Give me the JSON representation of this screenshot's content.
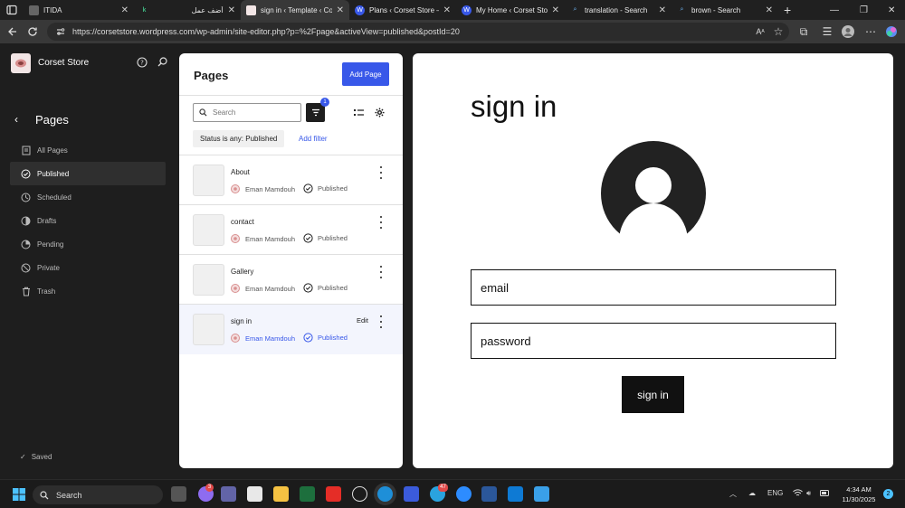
{
  "browser": {
    "tabs": [
      {
        "label": "ITIDA",
        "active": false
      },
      {
        "label": "أضف عمل",
        "active": false
      },
      {
        "label": "sign in ‹ Template ‹ Cor",
        "active": true
      },
      {
        "label": "Plans ‹ Corset Store — ",
        "active": false
      },
      {
        "label": "My Home ‹ Corset Stor",
        "active": false
      },
      {
        "label": "translation - Search",
        "active": false
      },
      {
        "label": "brown - Search",
        "active": false
      }
    ],
    "url": "https://corsetstore.wordpress.com/wp-admin/site-editor.php?p=%2Fpage&activeView=published&postId=20"
  },
  "sidebar": {
    "site_name": "Corset Store",
    "title": "Pages",
    "items": [
      {
        "label": "All Pages",
        "icon": "pages-icon",
        "selected": false
      },
      {
        "label": "Published",
        "icon": "published-icon",
        "selected": true
      },
      {
        "label": "Scheduled",
        "icon": "scheduled-icon",
        "selected": false
      },
      {
        "label": "Drafts",
        "icon": "drafts-icon",
        "selected": false
      },
      {
        "label": "Pending",
        "icon": "pending-icon",
        "selected": false
      },
      {
        "label": "Private",
        "icon": "private-icon",
        "selected": false
      },
      {
        "label": "Trash",
        "icon": "trash-icon",
        "selected": false
      }
    ],
    "saved_label": "Saved"
  },
  "pages_panel": {
    "title": "Pages",
    "add_label": "Add Page",
    "search_placeholder": "Search",
    "filter_count": "1",
    "filter_chip": "Status is any: Published",
    "add_filter": "Add filter",
    "rows": [
      {
        "title": "About",
        "author": "Eman Mamdouh",
        "status": "Published",
        "highlighted": false
      },
      {
        "title": "contact",
        "author": "Eman Mamdouh",
        "status": "Published",
        "highlighted": false
      },
      {
        "title": "Gallery",
        "author": "Eman Mamdouh",
        "status": "Published",
        "highlighted": false
      },
      {
        "title": "sign in",
        "author": "Eman Mamdouh",
        "status": "Published",
        "highlighted": true,
        "action": "Edit"
      }
    ]
  },
  "preview": {
    "heading": "sign in",
    "email_placeholder": "email",
    "password_placeholder": "password",
    "button": "sign in"
  },
  "taskbar": {
    "search_label": "Search",
    "chat_badge": "3",
    "telegram_badge": "47",
    "language": "ENG",
    "time": "4:34 AM",
    "date": "11/30/2025",
    "notif_count": "2"
  },
  "colors": {
    "accent": "#3858e9",
    "sidebar_bg": "#1e1e1e",
    "preview_button": "#111111"
  }
}
